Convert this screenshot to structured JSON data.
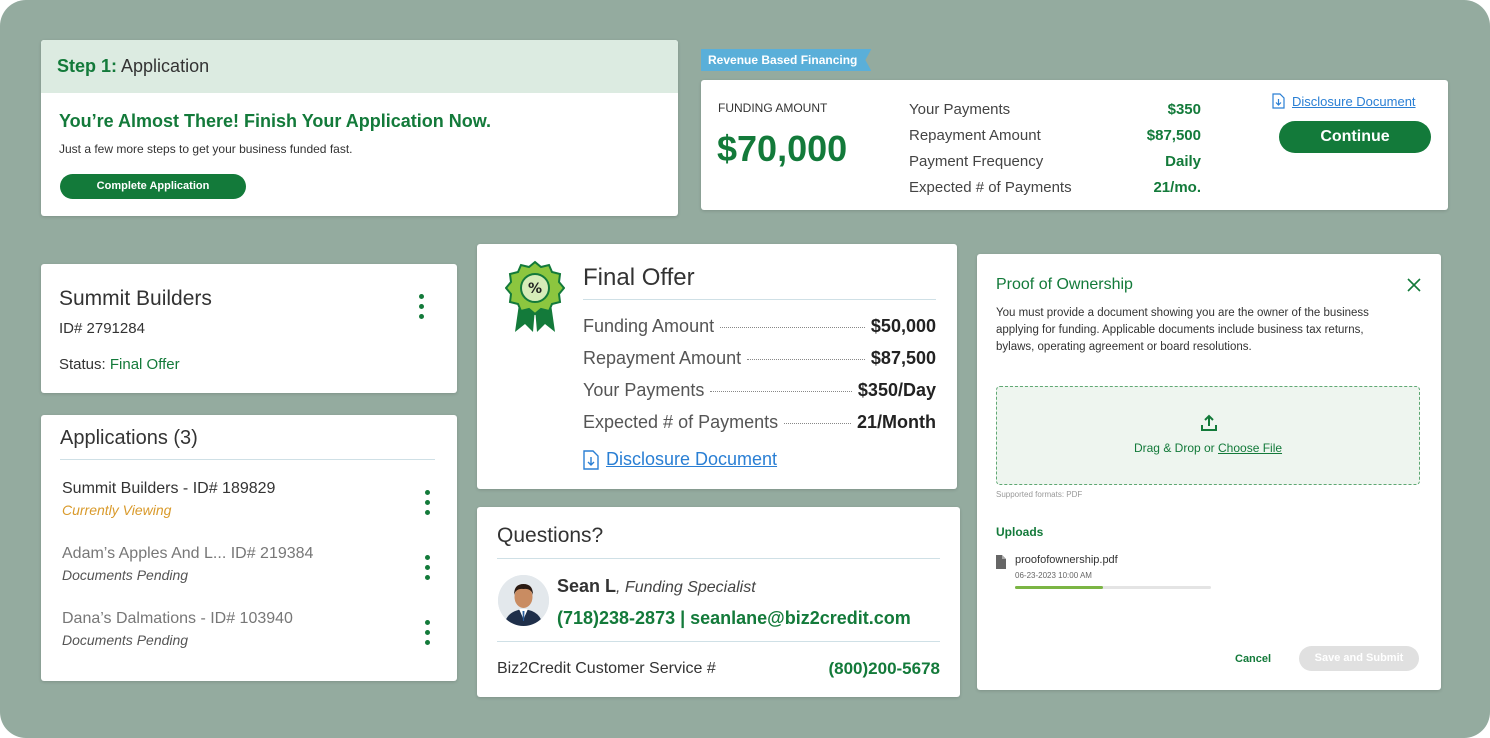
{
  "step1": {
    "step_label": "Step 1:",
    "step_name": "Application",
    "title": "You’re Almost There! Finish Your Application Now.",
    "subtitle": "Just a few more steps to get your business funded fast.",
    "button": "Complete Application"
  },
  "rbf": {
    "tag": "Revenue Based Financing",
    "funding_label": "FUNDING AMOUNT",
    "funding_amount": "$70,000",
    "rows": [
      {
        "label": "Your Payments",
        "value": "$350"
      },
      {
        "label": "Repayment Amount",
        "value": "$87,500"
      },
      {
        "label": "Payment Frequency",
        "value": "Daily"
      },
      {
        "label": "Expected # of Payments",
        "value": "21/mo."
      }
    ],
    "disclosure": "Disclosure Document",
    "continue": "Continue"
  },
  "summit": {
    "name": "Summit Builders",
    "id": "ID# 2791284",
    "status_label": "Status:",
    "status_value": "Final Offer"
  },
  "applications": {
    "title": "Applications (3)",
    "items": [
      {
        "name": "Summit Builders - ID# 189829",
        "sub": "Currently Viewing"
      },
      {
        "name": "Adam’s Apples And L... ID# 219384",
        "sub": "Documents Pending"
      },
      {
        "name": "Dana’s Dalmations - ID# 103940",
        "sub": "Documents Pending"
      }
    ]
  },
  "final_offer": {
    "title": "Final Offer",
    "rows": [
      {
        "label": "Funding Amount",
        "value": "$50,000"
      },
      {
        "label": "Repayment Amount",
        "value": "$87,500"
      },
      {
        "label": "Your Payments",
        "value": "$350/Day"
      },
      {
        "label": "Expected # of Payments",
        "value": "21/Month"
      }
    ],
    "disclosure": "Disclosure Document"
  },
  "questions": {
    "title": "Questions?",
    "name": "Sean L",
    "role": ", Funding Specialist",
    "contact": "(718)238-2873 | seanlane@biz2credit.com",
    "cs_label": "Biz2Credit Customer Service #",
    "cs_number": "(800)200-5678"
  },
  "proof": {
    "title": "Proof of Ownership",
    "description": "You must provide a document showing you are the owner of the business applying for funding. Applicable documents include business tax returns, bylaws, operating agreement or board resolutions.",
    "drop_text": "Drag & Drop or ",
    "choose_file": "Choose File",
    "formats": "Supported formats: PDF",
    "uploads_label": "Uploads",
    "file_name": "proofofownership.pdf",
    "file_date": "06-23-2023   10:00 AM",
    "upload_progress": 0.45,
    "cancel": "Cancel",
    "submit": "Save and Submit"
  },
  "colors": {
    "brand_green": "#137a3a",
    "background": "#94ab9f",
    "link_blue": "#2a7fd4",
    "viewing_orange": "#d99a2b",
    "progress_green": "#7bb544"
  }
}
